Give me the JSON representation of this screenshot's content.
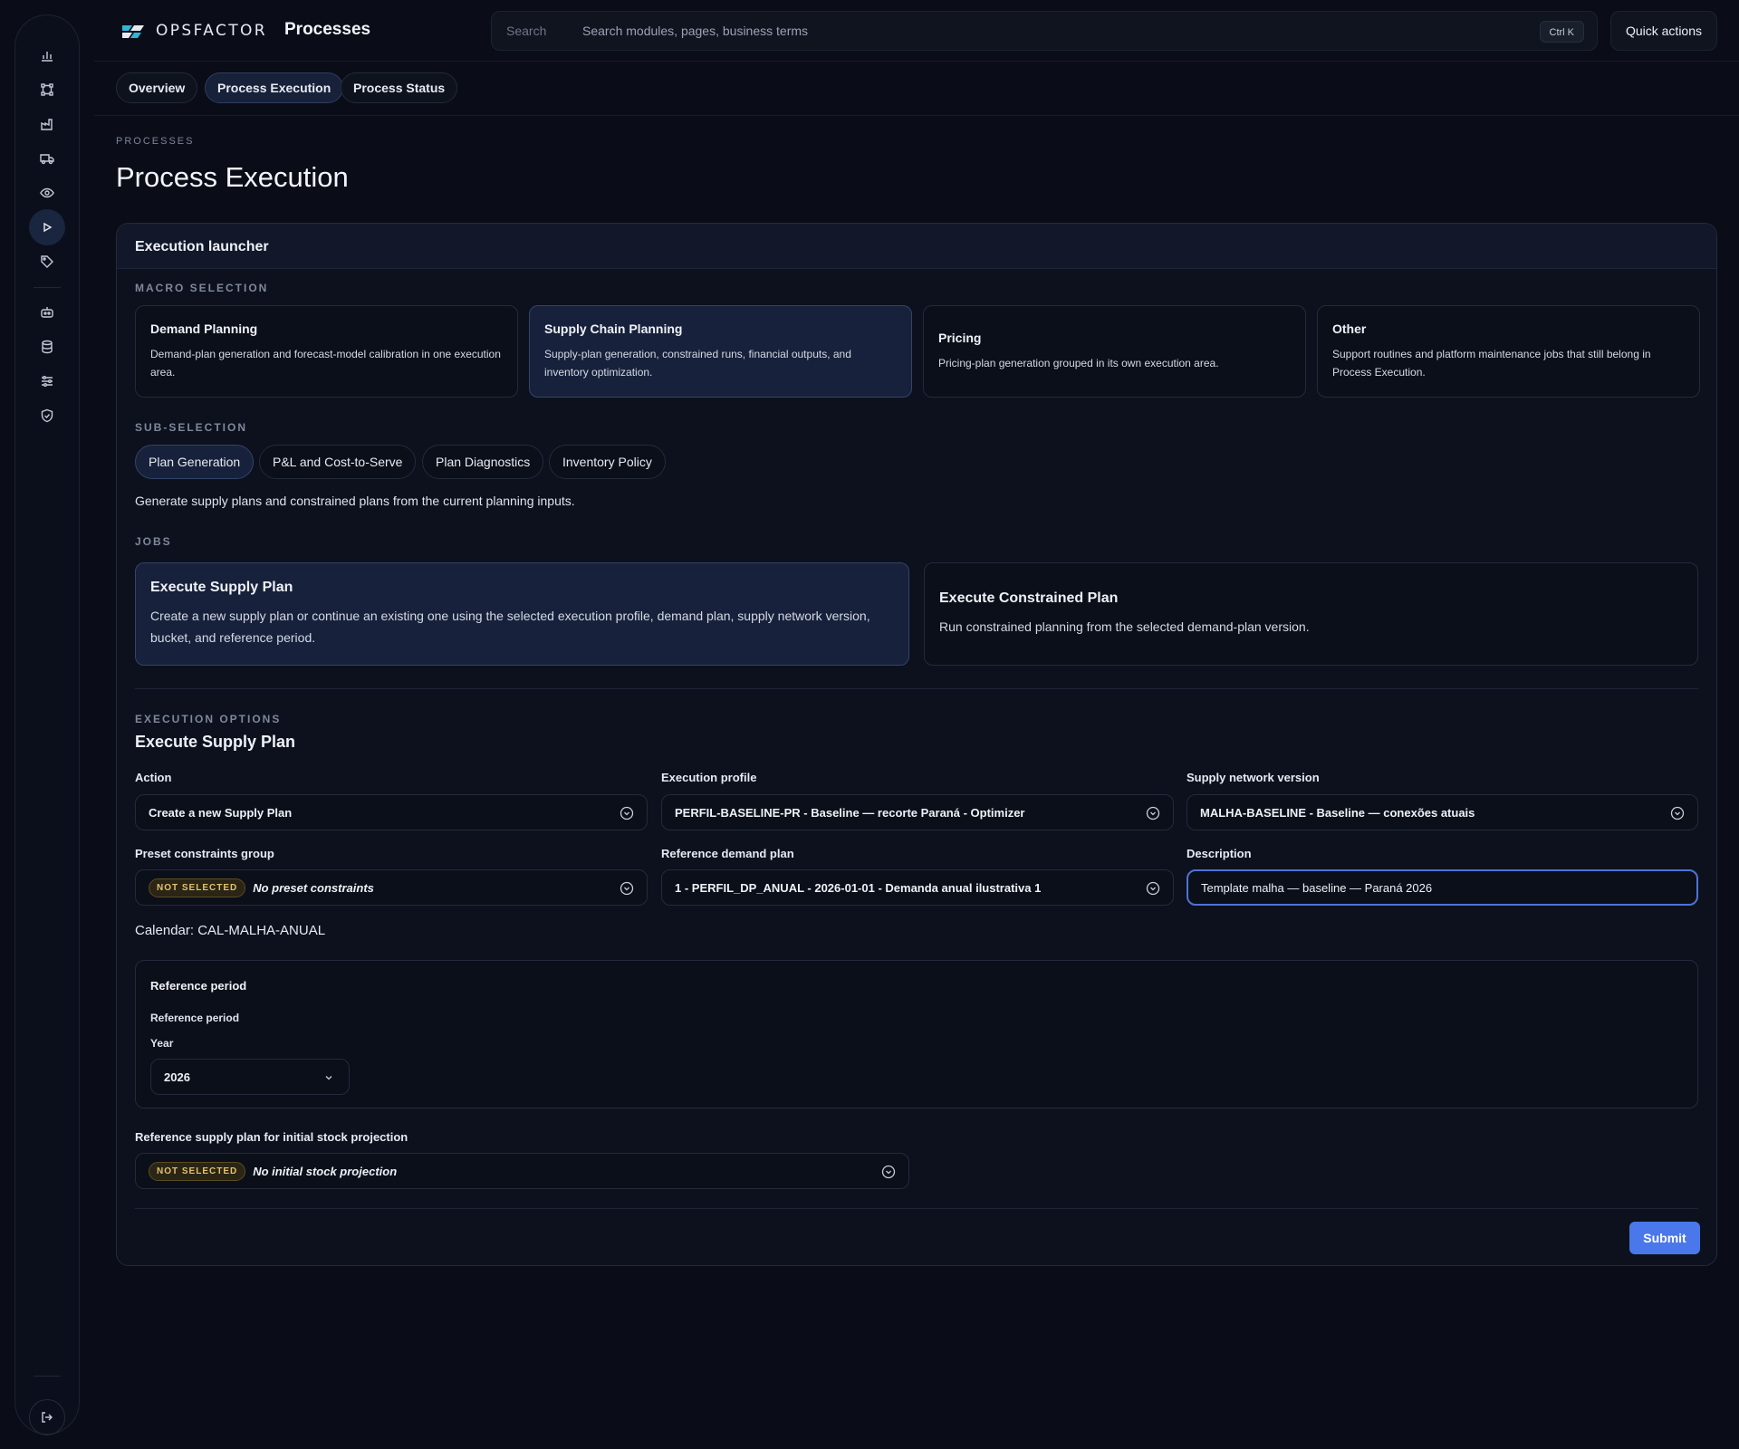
{
  "app": {
    "brand": "OPSFACTOR",
    "section_title": "Processes"
  },
  "search": {
    "label": "Search",
    "placeholder": "Search modules, pages, business terms",
    "shortcut": "Ctrl K"
  },
  "header": {
    "quick_actions": "Quick actions"
  },
  "sidebar": {
    "icons": [
      "chart-bar-icon",
      "network-icon",
      "factory-icon",
      "truck-icon",
      "eye-icon",
      "play-icon",
      "tag-icon",
      "robot-icon",
      "database-icon",
      "sliders-icon",
      "shield-icon",
      "logout-icon"
    ],
    "active": "play-icon"
  },
  "tabs": [
    {
      "label": "Overview"
    },
    {
      "label": "Process Execution"
    },
    {
      "label": "Process Status"
    }
  ],
  "page": {
    "breadcrumb": "PROCESSES",
    "title": "Process Execution"
  },
  "launcher": {
    "title": "Execution launcher",
    "macro_label": "MACRO SELECTION",
    "macros": [
      {
        "title": "Demand Planning",
        "desc": "Demand-plan generation and forecast-model calibration in one execution area."
      },
      {
        "title": "Supply Chain Planning",
        "desc": "Supply-plan generation, constrained runs, financial outputs, and inventory optimization."
      },
      {
        "title": "Pricing",
        "desc": "Pricing-plan generation grouped in its own execution area."
      },
      {
        "title": "Other",
        "desc": "Support routines and platform maintenance jobs that still belong in Process Execution."
      }
    ],
    "sub_label": "SUB-SELECTION",
    "subs": [
      {
        "label": "Plan Generation"
      },
      {
        "label": "P&L and Cost-to-Serve"
      },
      {
        "label": "Plan Diagnostics"
      },
      {
        "label": "Inventory Policy"
      }
    ],
    "sub_desc": "Generate supply plans and constrained plans from the current planning inputs.",
    "jobs_label": "JOBS",
    "jobs": [
      {
        "title": "Execute Supply Plan",
        "desc": "Create a new supply plan or continue an existing one using the selected execution profile, demand plan, supply network version, bucket, and reference period."
      },
      {
        "title": "Execute Constrained Plan",
        "desc": "Run constrained planning from the selected demand-plan version."
      }
    ]
  },
  "options": {
    "label": "EXECUTION OPTIONS",
    "title": "Execute Supply Plan",
    "action": {
      "label": "Action",
      "value": "Create a new Supply Plan"
    },
    "profile": {
      "label": "Execution profile",
      "value": "PERFIL-BASELINE-PR - Baseline — recorte Paraná - Optimizer"
    },
    "network": {
      "label": "Supply network version",
      "value": "MALHA-BASELINE - Baseline — conexões atuais"
    },
    "constraints": {
      "label": "Preset constraints group",
      "badge": "NOT SELECTED",
      "value": "No preset constraints"
    },
    "demand_plan": {
      "label": "Reference demand plan",
      "value": "1 - PERFIL_DP_ANUAL - 2026-01-01 - Demanda anual ilustrativa 1"
    },
    "description": {
      "label": "Description",
      "value": "Template malha — baseline — Paraná 2026"
    },
    "calendar": "Calendar: CAL-MALHA-ANUAL",
    "reference": {
      "title": "Reference period",
      "subtitle": "Reference period",
      "year_label": "Year",
      "year_value": "2026"
    },
    "stock": {
      "label": "Reference supply plan for initial stock projection",
      "badge": "NOT SELECTED",
      "value": "No initial stock projection"
    },
    "submit": "Submit"
  }
}
